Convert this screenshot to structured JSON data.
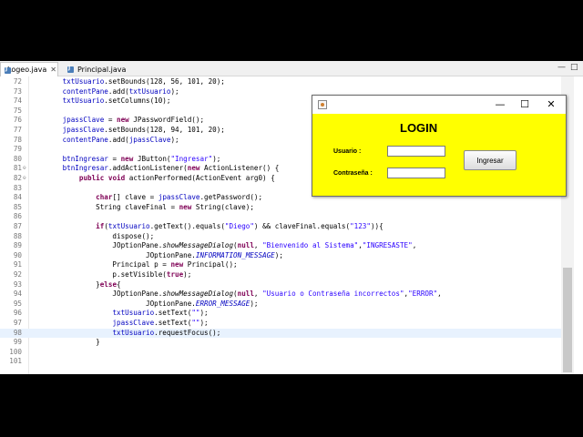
{
  "editor": {
    "tabs": [
      {
        "label": "Logeo.java",
        "active": true
      },
      {
        "label": "Principal.java",
        "active": false
      }
    ],
    "window_controls": {
      "minimize": "—",
      "maximize": "□"
    },
    "lines": [
      {
        "n": "72",
        "text": "        txtUsuario.setBounds(128, 56, 101, 20);"
      },
      {
        "n": "73",
        "text": "        contentPane.add(txtUsuario);"
      },
      {
        "n": "74",
        "text": "        txtUsuario.setColumns(10);"
      },
      {
        "n": "75",
        "text": ""
      },
      {
        "n": "76",
        "text": "        jpassClave = new JPasswordField();"
      },
      {
        "n": "77",
        "text": "        jpassClave.setBounds(128, 94, 101, 20);"
      },
      {
        "n": "78",
        "text": "        contentPane.add(jpassClave);"
      },
      {
        "n": "79",
        "text": ""
      },
      {
        "n": "80",
        "text": "        btnIngresar = new JButton(\"Ingresar\");"
      },
      {
        "n": "81",
        "text": "        btnIngresar.addActionListener(new ActionListener() {"
      },
      {
        "n": "82",
        "text": "            public void actionPerformed(ActionEvent arg0) {"
      },
      {
        "n": "83",
        "text": ""
      },
      {
        "n": "84",
        "text": "                char[] clave = jpassClave.getPassword();"
      },
      {
        "n": "85",
        "text": "                String claveFinal = new String(clave);"
      },
      {
        "n": "86",
        "text": ""
      },
      {
        "n": "87",
        "text": "                if(txtUsuario.getText().equals(\"Diego\") && claveFinal.equals(\"123\")){"
      },
      {
        "n": "88",
        "text": "                    dispose();"
      },
      {
        "n": "89",
        "text": "                    JOptionPane.showMessageDialog(null, \"Bienvenido al Sistema\",\"INGRESASTE\","
      },
      {
        "n": "90",
        "text": "                            JOptionPane.INFORMATION_MESSAGE);"
      },
      {
        "n": "91",
        "text": "                    Principal p = new Principal();"
      },
      {
        "n": "92",
        "text": "                    p.setVisible(true);"
      },
      {
        "n": "93",
        "text": "                }else{"
      },
      {
        "n": "94",
        "text": "                    JOptionPane.showMessageDialog(null, \"Usuario o Contraseña incorrectos\",\"ERROR\","
      },
      {
        "n": "95",
        "text": "                            JOptionPane.ERROR_MESSAGE);"
      },
      {
        "n": "96",
        "text": "                    txtUsuario.setText(\"\");"
      },
      {
        "n": "97",
        "text": "                    jpassClave.setText(\"\");"
      },
      {
        "n": "98",
        "text": "                    txtUsuario.requestFocus();"
      },
      {
        "n": "99",
        "text": "                }"
      },
      {
        "n": "100",
        "text": ""
      },
      {
        "n": "101",
        "text": ""
      }
    ],
    "current_line": "98",
    "fold_markers": [
      "81",
      "82"
    ],
    "colors": {
      "keyword": "#7f0055",
      "field": "#0000c0",
      "string": "#2a00ff"
    }
  },
  "dialog": {
    "title_icon": "java-app-icon",
    "controls": {
      "minimize": "—",
      "maximize": "☐",
      "close": "✕"
    },
    "heading": "LOGIN",
    "usuario_label": "Usuario :",
    "clave_label": "Contraseña :",
    "usuario_value": "",
    "clave_value": "",
    "button_label": "Ingresar",
    "background": "#ffff00"
  }
}
